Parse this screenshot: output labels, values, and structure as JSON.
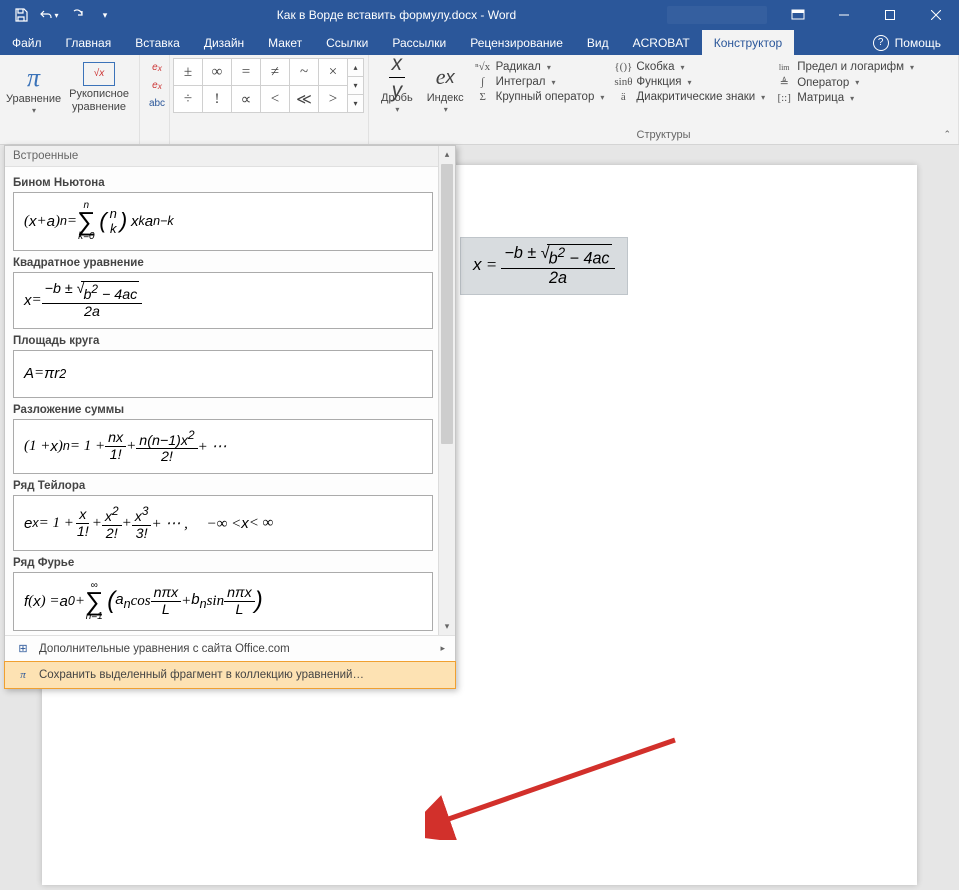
{
  "title": "Как в Ворде вставить формулу.docx - Word",
  "help_label": "Помощь",
  "tabs": [
    "Файл",
    "Главная",
    "Вставка",
    "Дизайн",
    "Макет",
    "Ссылки",
    "Рассылки",
    "Рецензирование",
    "Вид",
    "ACROBAT",
    "Конструктор"
  ],
  "active_tab": 10,
  "ribbon": {
    "equation_btn": "Уравнение",
    "ink_btn": "Рукописное\nуравнение",
    "struct_group": "Структуры",
    "frac": "Дробь",
    "index": "Индекс",
    "radical": "Радикал",
    "integral": "Интеграл",
    "large_op": "Крупный оператор",
    "bracket": "Скобка",
    "function": "Функция",
    "diacritic": "Диакритические знаки",
    "limit": "Предел и логарифм",
    "operator": "Оператор",
    "matrix": "Матрица"
  },
  "symbols_row1": [
    "±",
    "∞",
    "=",
    "≠",
    "~",
    "×"
  ],
  "symbols_row2": [
    "÷",
    "!",
    "∝",
    "<",
    "≪",
    ">"
  ],
  "gallery": {
    "header": "Встроенные",
    "items": [
      {
        "title": "Бином Ньютона"
      },
      {
        "title": "Квадратное уравнение"
      },
      {
        "title": "Площадь круга"
      },
      {
        "title": "Разложение суммы"
      },
      {
        "title": "Ряд Тейлора"
      },
      {
        "title": "Ряд Фурье"
      }
    ],
    "footer_more": "Дополнительные уравнения с сайта Office.com",
    "footer_save": "Сохранить выделенный фрагмент в коллекцию уравнений…"
  }
}
